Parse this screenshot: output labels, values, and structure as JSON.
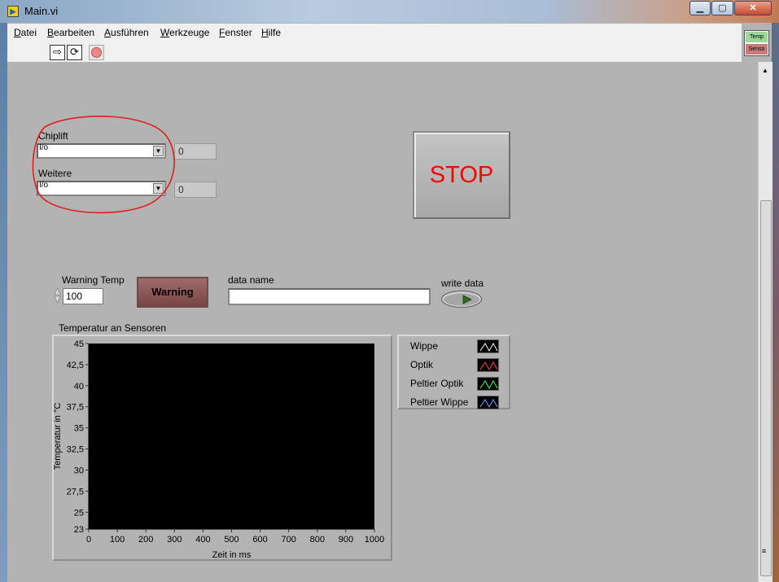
{
  "window": {
    "title": "Main.vi",
    "minimize": "▁",
    "maximize": "▢",
    "close": "✕"
  },
  "menu": [
    "Datei",
    "Bearbeiten",
    "Ausführen",
    "Werkzeuge",
    "Fenster",
    "Hilfe"
  ],
  "vi_icon": {
    "top": "Temp",
    "bottom": "Senso"
  },
  "chiplift": {
    "label": "Chiplift",
    "radix": "I/o",
    "value": "",
    "indicator": "0"
  },
  "weitere": {
    "label": "Weitere",
    "radix": "I/o",
    "value": "",
    "indicator": "0"
  },
  "stop": {
    "label": "STOP"
  },
  "warning_temp": {
    "label": "Warning Temp",
    "value": "100"
  },
  "warning": {
    "label": "Warning"
  },
  "data_name": {
    "label": "data name",
    "value": ""
  },
  "write_data": {
    "label": "write data"
  },
  "colors": {
    "panel": "#b3b3b3",
    "plot_bg": "#000000",
    "stop_text": "#ff0000",
    "annotation": "#e02020"
  },
  "chart_data": {
    "type": "line",
    "title": "Temperatur an Sensoren",
    "xlabel": "Zeit in ms",
    "ylabel": "Temperatur in °C",
    "xlim": [
      0,
      1000
    ],
    "ylim": [
      23,
      45
    ],
    "xticks": [
      "0",
      "100",
      "200",
      "300",
      "400",
      "500",
      "600",
      "700",
      "800",
      "900",
      "1000"
    ],
    "yticks": [
      "45",
      "42,5",
      "40",
      "37,5",
      "35",
      "32,5",
      "30",
      "27,5",
      "25",
      "23"
    ],
    "ytick_values": [
      45,
      42.5,
      40,
      37.5,
      35,
      32.5,
      30,
      27.5,
      25,
      23
    ],
    "grid": false,
    "series": [
      {
        "name": "Wippe",
        "color": "#ffffff",
        "values": []
      },
      {
        "name": "Optik",
        "color": "#ff4040",
        "values": []
      },
      {
        "name": "Peltier Optik",
        "color": "#40ff40",
        "values": []
      },
      {
        "name": "Peltier Wippe",
        "color": "#6fa0ff",
        "values": []
      }
    ]
  }
}
